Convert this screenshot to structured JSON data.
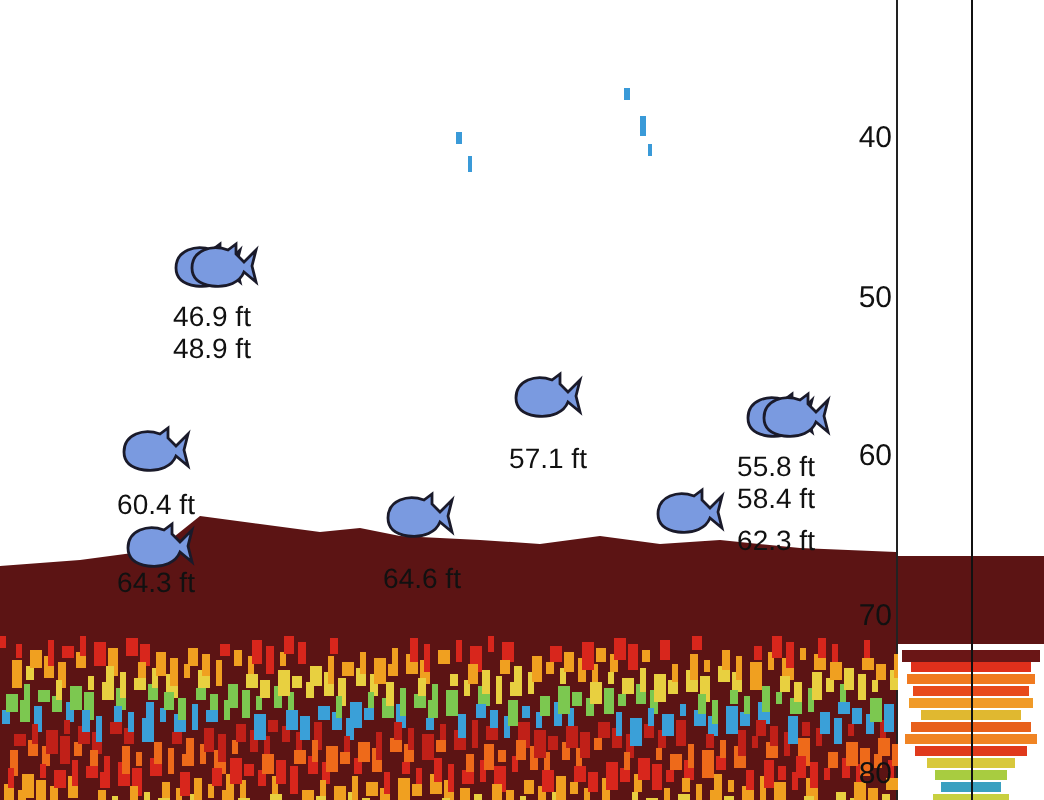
{
  "fish_marks": [
    {
      "label": "46.9 ft"
    },
    {
      "label": "48.9 ft"
    },
    {
      "label": "60.4 ft"
    },
    {
      "label": "64.3 ft"
    },
    {
      "label": "64.6 ft"
    },
    {
      "label": "57.1 ft"
    },
    {
      "label": "55.8 ft"
    },
    {
      "label": "58.4 ft"
    },
    {
      "label": "62.3 ft"
    }
  ],
  "depth_scale": [
    "40",
    "50",
    "60",
    "70",
    "80"
  ]
}
